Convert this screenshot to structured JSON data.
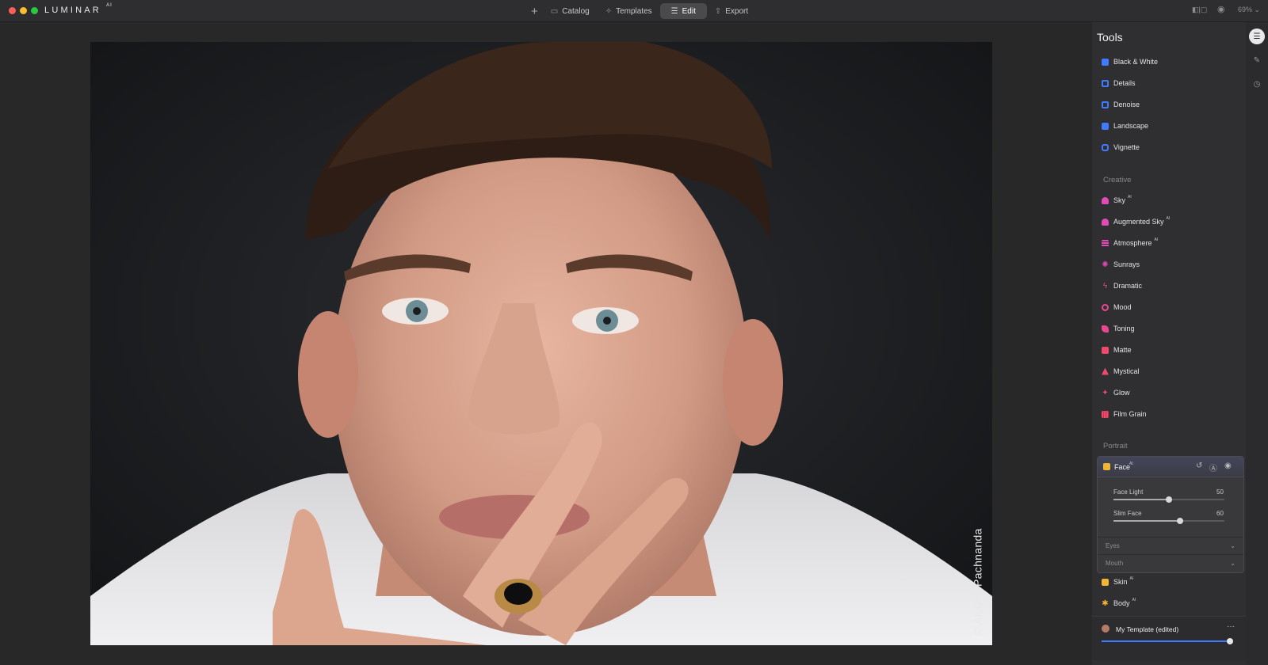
{
  "app": {
    "brand": "LUMINAR",
    "brand_suffix": "AI"
  },
  "nav": {
    "catalog": "Catalog",
    "templates": "Templates",
    "edit": "Edit",
    "export": "Export"
  },
  "toolbar": {
    "zoom": "69%"
  },
  "photo": {
    "watermark": "© Aiyush Pachnanda"
  },
  "panel": {
    "title": "Tools",
    "essentials": [
      {
        "label": "Black & White",
        "color": "#3f7bff"
      },
      {
        "label": "Details",
        "color": "#3f7bff"
      },
      {
        "label": "Denoise",
        "color": "#3f7bff"
      },
      {
        "label": "Landscape",
        "color": "#3f7bff"
      },
      {
        "label": "Vignette",
        "color": "#3f7bff"
      }
    ],
    "creative_heading": "Creative",
    "creative": [
      {
        "label": "Sky",
        "ai": "AI",
        "color": "#e24bb7"
      },
      {
        "label": "Augmented Sky",
        "ai": "AI",
        "color": "#e24bb7"
      },
      {
        "label": "Atmosphere",
        "ai": "AI",
        "color": "#e24bb7"
      },
      {
        "label": "Sunrays",
        "ai": "",
        "color": "#e24bb7"
      },
      {
        "label": "Dramatic",
        "ai": "",
        "color": "#e9488f"
      },
      {
        "label": "Mood",
        "ai": "",
        "color": "#e9488f"
      },
      {
        "label": "Toning",
        "ai": "",
        "color": "#e9488f"
      },
      {
        "label": "Matte",
        "ai": "",
        "color": "#ee4a6e"
      },
      {
        "label": "Mystical",
        "ai": "",
        "color": "#ee4a6e"
      },
      {
        "label": "Glow",
        "ai": "",
        "color": "#ee4a6e"
      },
      {
        "label": "Film Grain",
        "ai": "",
        "color": "#ee4a6e"
      }
    ],
    "portrait_heading": "Portrait",
    "face": {
      "label": "Face",
      "ai": "AI",
      "sliders": [
        {
          "label": "Face Light",
          "value": 50,
          "value_text": "50"
        },
        {
          "label": "Slim Face",
          "value": 60,
          "value_text": "60"
        }
      ],
      "eyes": "Eyes",
      "mouth": "Mouth"
    },
    "skin": {
      "label": "Skin",
      "ai": "AI"
    },
    "body": {
      "label": "Body",
      "ai": "AI"
    },
    "template": {
      "label": "My Template (edited)",
      "amount": 100
    }
  },
  "colors": {
    "accent_blue": "#3f7bff",
    "creative_pink": "#e24bb7",
    "portrait_yellow": "#f2b531"
  }
}
